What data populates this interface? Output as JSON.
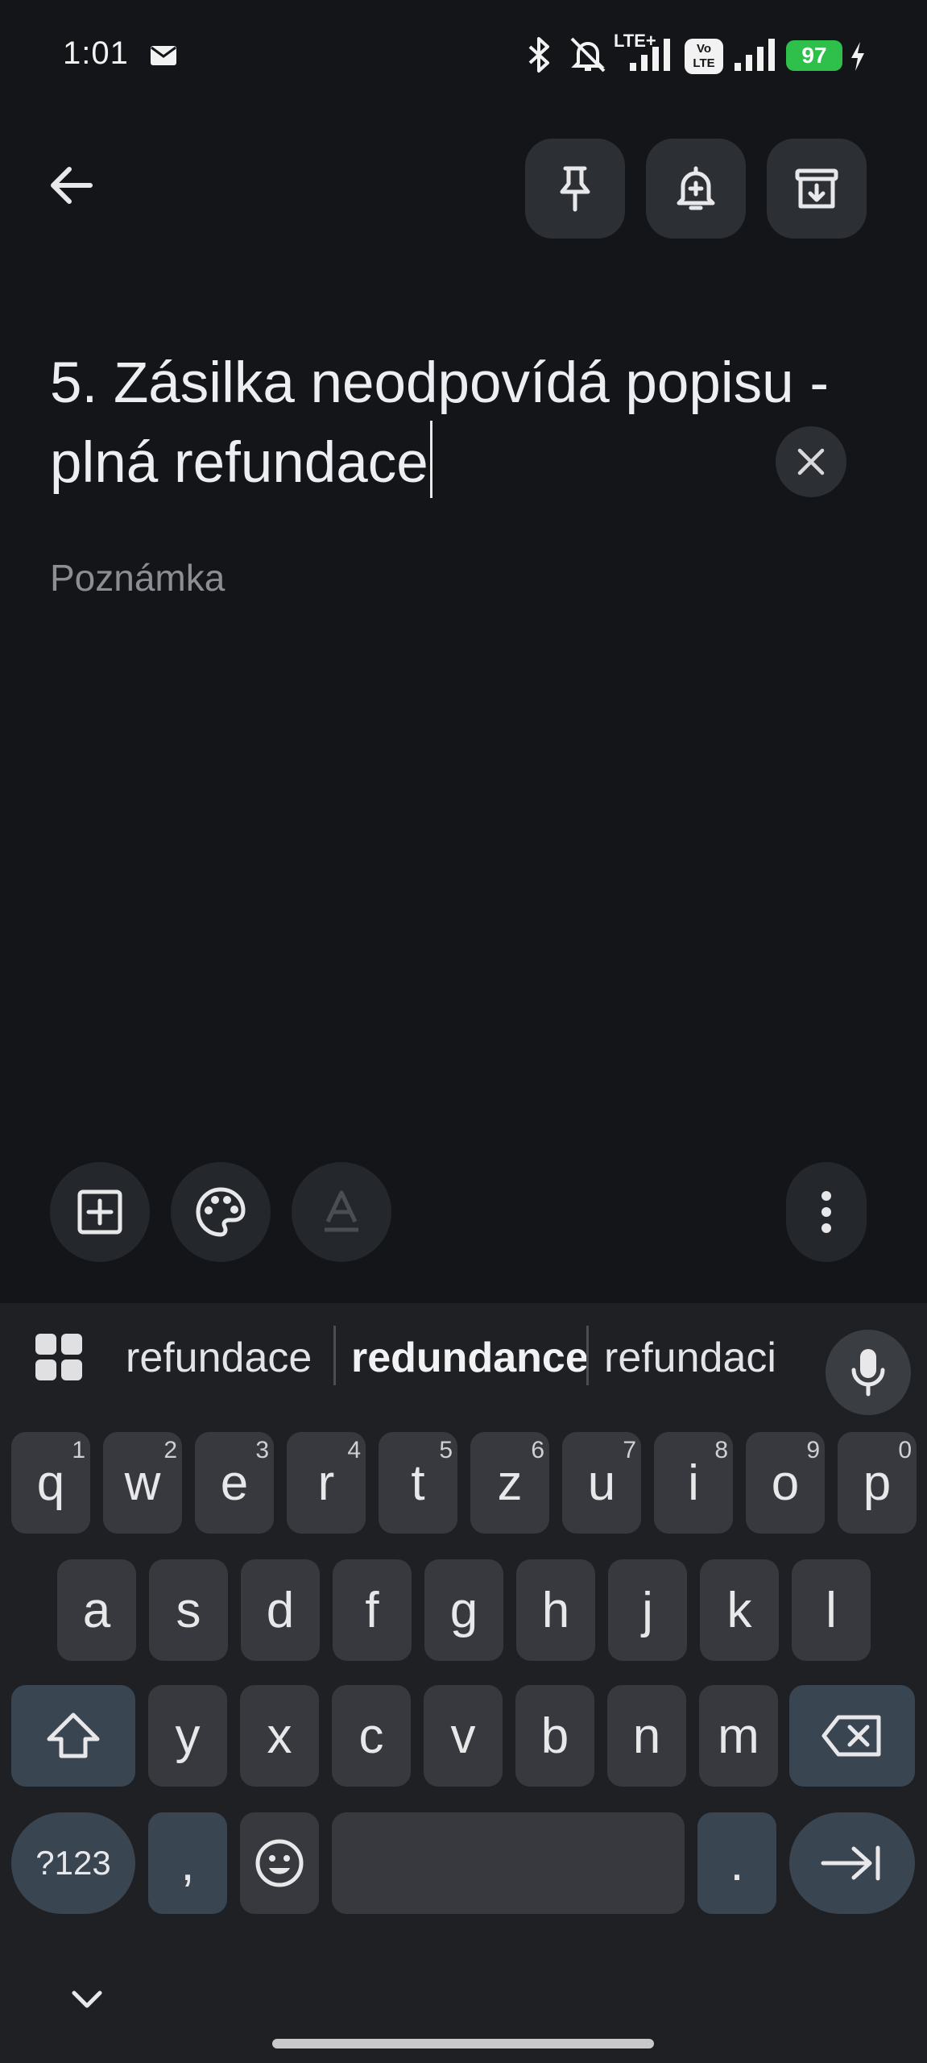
{
  "status_bar": {
    "time": "1:01",
    "network_label": "LTE+",
    "volte_label": "Vo LTE",
    "battery": "97",
    "battery_color": "#2fbf4b",
    "icons": [
      "gmail-icon",
      "bluetooth-icon",
      "silent-icon",
      "signal-icon",
      "volte-icon",
      "signal-icon",
      "battery-icon",
      "charging-icon"
    ]
  },
  "app_bar": {
    "back_icon": "arrow-back-icon",
    "actions": [
      "pin-icon",
      "reminder-icon",
      "archive-icon"
    ]
  },
  "note": {
    "title": "5. Zásilka neodpovídá popisu - plná refundace",
    "body_placeholder": "Poznámka"
  },
  "bottom_toolbar": {
    "actions": [
      "add-box-icon",
      "palette-icon",
      "text-format-icon",
      "more-vert-icon"
    ]
  },
  "keyboard": {
    "suggestions": [
      "refundace",
      "redundance",
      "refundaci"
    ],
    "row1": [
      {
        "k": "q",
        "h": "1"
      },
      {
        "k": "w",
        "h": "2"
      },
      {
        "k": "e",
        "h": "3"
      },
      {
        "k": "r",
        "h": "4"
      },
      {
        "k": "t",
        "h": "5"
      },
      {
        "k": "z",
        "h": "6"
      },
      {
        "k": "u",
        "h": "7"
      },
      {
        "k": "i",
        "h": "8"
      },
      {
        "k": "o",
        "h": "9"
      },
      {
        "k": "p",
        "h": "0"
      }
    ],
    "row2": [
      "a",
      "s",
      "d",
      "f",
      "g",
      "h",
      "j",
      "k",
      "l"
    ],
    "row3": [
      "y",
      "x",
      "c",
      "v",
      "b",
      "n",
      "m"
    ],
    "symbols_label": "?123",
    "comma": ",",
    "period": ".",
    "accent_key_color": "#3a4552"
  }
}
